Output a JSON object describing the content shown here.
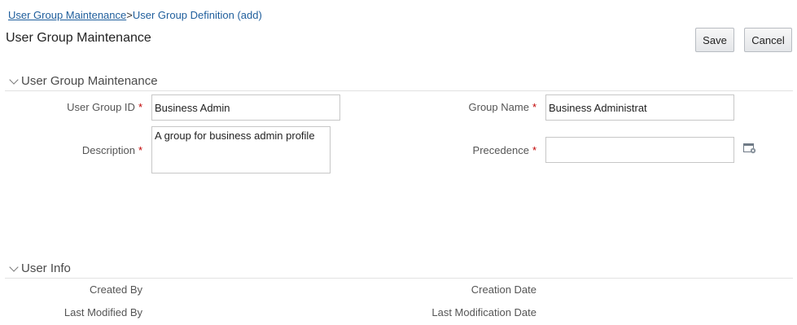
{
  "breadcrumb": {
    "link": "User Group Maintenance",
    "separator": ">",
    "current": "User Group Definition (add)"
  },
  "page_title": "User Group Maintenance",
  "toolbar": {
    "save_label": "Save",
    "cancel_label": "Cancel"
  },
  "sections": {
    "maintenance": {
      "title": "User Group Maintenance",
      "fields": {
        "user_group_id": {
          "label": "User Group ID",
          "value": "Business Admin",
          "required": "*"
        },
        "group_name": {
          "label": "Group Name",
          "value": "Business Administrat",
          "required": "*"
        },
        "description": {
          "label": "Description",
          "value": "A group for business admin profile",
          "required": "*"
        },
        "precedence": {
          "label": "Precedence",
          "value": "",
          "required": "*",
          "icon": "lookup-icon"
        }
      }
    },
    "user_info": {
      "title": "User Info",
      "created_by_label": "Created By",
      "creation_date_label": "Creation Date",
      "last_modified_by_label": "Last Modified By",
      "last_modification_date_label": "Last Modification Date"
    }
  },
  "colors": {
    "link": "#1f5e9c",
    "required": "#c00000",
    "rule": "#e2e2e2"
  }
}
